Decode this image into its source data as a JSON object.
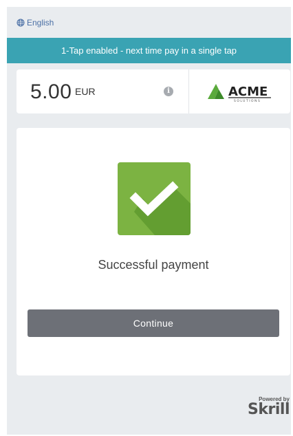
{
  "header": {
    "language_label": "English",
    "language_icon": "globe-icon"
  },
  "banner": {
    "text": "1-Tap enabled - next time pay in a single tap",
    "color": "#3aa3b3"
  },
  "amount": {
    "value": "5.00",
    "currency": "EUR",
    "info_icon": "info-icon"
  },
  "merchant": {
    "logo_text": "ACME",
    "logo_subtext": "SOLUTIONS",
    "logo_color": "#5aaa3c"
  },
  "status": {
    "icon": "checkmark-icon",
    "icon_color": "#7cb342",
    "message": "Successful payment"
  },
  "actions": {
    "continue_label": "Continue",
    "continue_color": "#6d7077"
  },
  "footer": {
    "powered_by_label": "Powered by",
    "brand": "Skrill"
  }
}
